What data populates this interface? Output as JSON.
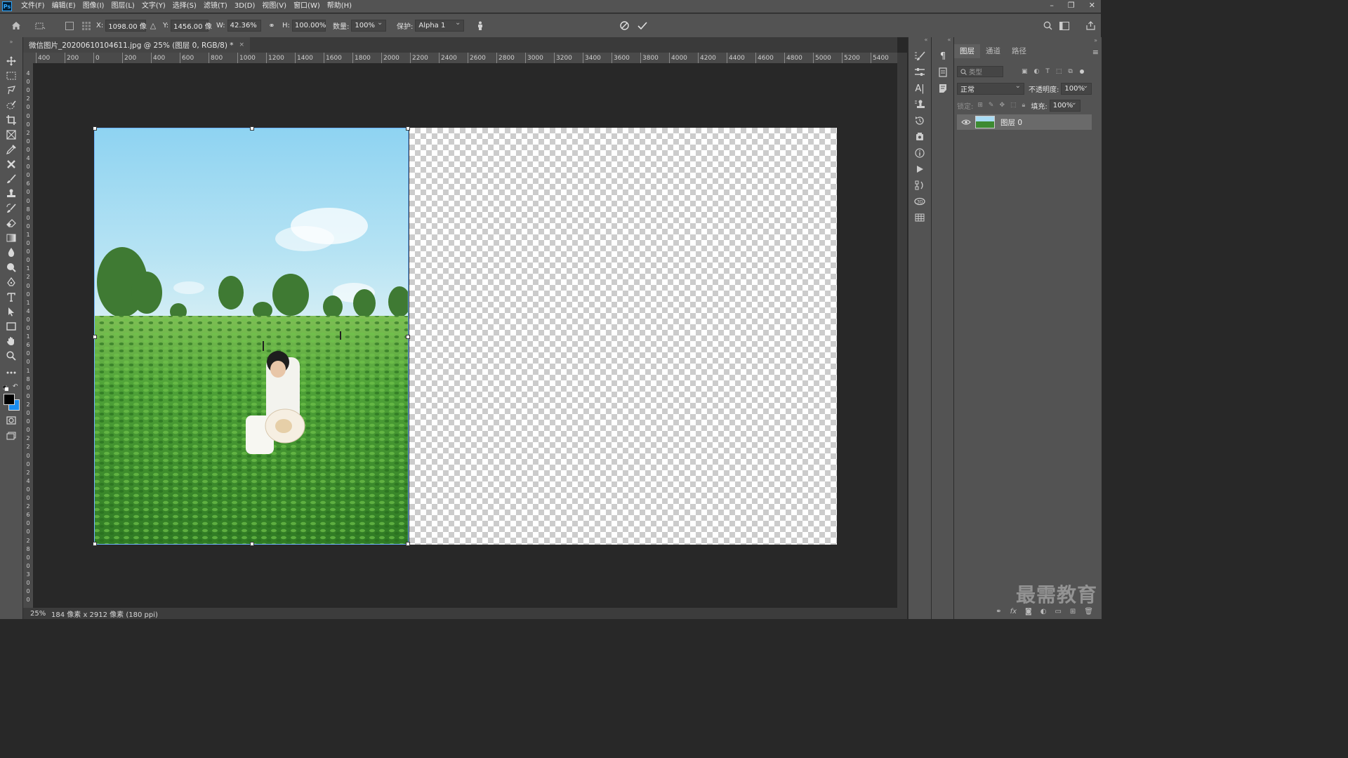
{
  "app": {
    "logo": "Ps",
    "menu": [
      "文件(F)",
      "编辑(E)",
      "图像(I)",
      "图层(L)",
      "文字(Y)",
      "选择(S)",
      "滤镜(T)",
      "3D(D)",
      "视图(V)",
      "窗口(W)",
      "帮助(H)"
    ],
    "window_controls": [
      "–",
      "❐",
      "✕"
    ]
  },
  "options": {
    "x_label": "X:",
    "x_value": "1098.00 像",
    "y_label": "Y:",
    "y_value": "1456.00 像",
    "w_label": "W:",
    "w_value": "42.36%",
    "h_label": "H:",
    "h_value": "100.00%",
    "amount_label": "数量:",
    "amount_value": "100%",
    "protect_label": "保护:",
    "protect_value": "Alpha 1"
  },
  "document": {
    "tab_title": "微信图片_20200610104611.jpg @ 25% (图层 0, RGB/8) *",
    "close": "×"
  },
  "rulers": {
    "horizontal": [
      "400",
      "200",
      "0",
      "200",
      "400",
      "600",
      "800",
      "1000",
      "1200",
      "1400",
      "1600",
      "1800",
      "2000",
      "2200",
      "2400",
      "2600",
      "2800",
      "3000",
      "3200",
      "3400",
      "3600",
      "3800",
      "4000",
      "4200",
      "4400",
      "4600",
      "4800",
      "5000",
      "5200",
      "5400"
    ],
    "vertical": [
      "4",
      "0",
      "0",
      "2",
      "0",
      "0",
      "0",
      "2",
      "0",
      "0",
      "4",
      "0",
      "0",
      "6",
      "0",
      "0",
      "8",
      "0",
      "0",
      "1",
      "0",
      "0",
      "0",
      "1",
      "2",
      "0",
      "0",
      "1",
      "4",
      "0",
      "0",
      "1",
      "6",
      "0",
      "0",
      "1",
      "8",
      "0",
      "0",
      "2",
      "0",
      "0",
      "0",
      "2",
      "2",
      "0",
      "0",
      "2",
      "4",
      "0",
      "0",
      "2",
      "6",
      "0",
      "0",
      "2",
      "8",
      "0",
      "0",
      "3",
      "0",
      "0",
      "0"
    ]
  },
  "status": {
    "zoom": "25%",
    "info": "184 像素 x 2912 像素 (180 ppi)"
  },
  "layers_panel": {
    "tabs": [
      "图层",
      "通道",
      "路径"
    ],
    "search_placeholder": "类型",
    "blend_mode": "正常",
    "opacity_label": "不透明度:",
    "opacity_value": "100%",
    "lock_label": "锁定:",
    "fill_label": "填充:",
    "fill_value": "100%",
    "layer_name": "图层 0",
    "footer_icons": [
      "link-icon",
      "fx-icon",
      "mask-icon",
      "adjustment-icon",
      "folder-icon",
      "new-layer-icon",
      "trash-icon"
    ],
    "fx_text": "fx"
  },
  "watermark": "最需教育",
  "colors": {
    "chrome": "#535353",
    "canvas_bg": "#282828",
    "accent": "#31a8ff",
    "selection": "#6fb6ff"
  }
}
